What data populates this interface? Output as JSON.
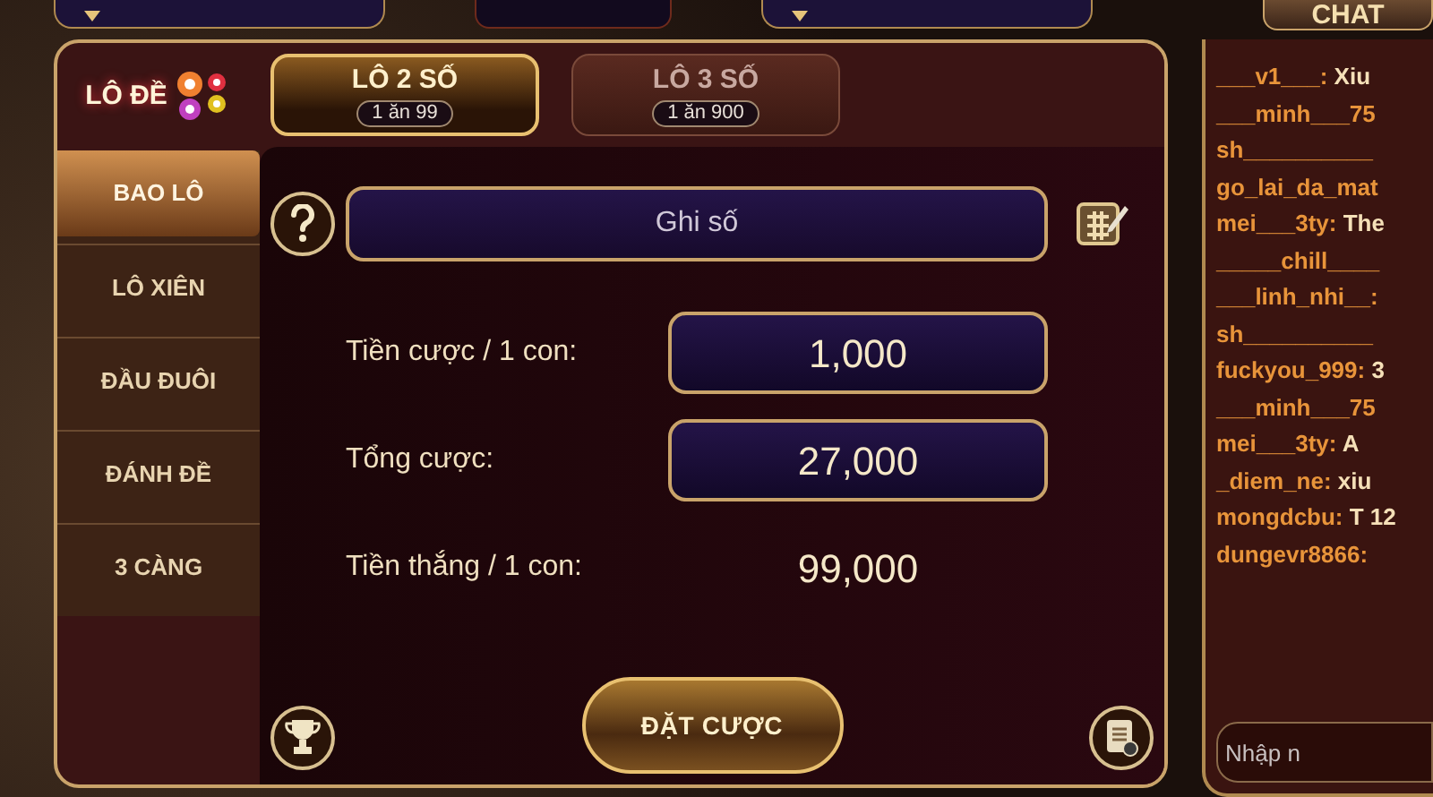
{
  "logo": {
    "text": "LÔ ĐỀ"
  },
  "tabs": [
    {
      "label": "LÔ 2 SỐ",
      "odds": "1 ăn 99",
      "selected": true
    },
    {
      "label": "LÔ 3 SỐ",
      "odds": "1 ăn 900",
      "selected": false
    }
  ],
  "sidebar": {
    "items": [
      {
        "label": "BAO LÔ",
        "selected": true
      },
      {
        "label": "LÔ XIÊN",
        "selected": false
      },
      {
        "label": "ĐẦU ĐUÔI",
        "selected": false
      },
      {
        "label": "ĐÁNH ĐỀ",
        "selected": false
      },
      {
        "label": "3 CÀNG",
        "selected": false
      }
    ]
  },
  "form": {
    "number_field": {
      "placeholder": "Ghi số"
    },
    "rows": [
      {
        "label": "Tiền cược / 1 con:",
        "value": "1,000",
        "kind": "field"
      },
      {
        "label": "Tổng cược:",
        "value": "27,000",
        "kind": "field"
      },
      {
        "label": "Tiền thắng / 1 con:",
        "value": "99,000",
        "kind": "text"
      }
    ],
    "submit": "ĐẶT CƯỢC"
  },
  "chat": {
    "button": "CHAT",
    "messages": [
      {
        "user": "___v1___:",
        "text": "Xiu"
      },
      {
        "user": "___minh___75"
      },
      {
        "user": "sh__________"
      },
      {
        "user": "go_lai_da_mat"
      },
      {
        "user": "mei___3ty:",
        "text": "The"
      },
      {
        "user": "_____chill____"
      },
      {
        "user": "___linh_nhi__:"
      },
      {
        "user": "sh__________"
      },
      {
        "user": "fuckyou_999:",
        "text": "3"
      },
      {
        "user": "___minh___75"
      },
      {
        "user": "mei___3ty:",
        "text": "A"
      },
      {
        "user": "_diem_ne:",
        "text": "xiu"
      },
      {
        "user": "mongdcbu:",
        "text": "T 12"
      },
      {
        "user": "dungevr8866:"
      }
    ],
    "input": {
      "placeholder": "Nhập n"
    }
  }
}
